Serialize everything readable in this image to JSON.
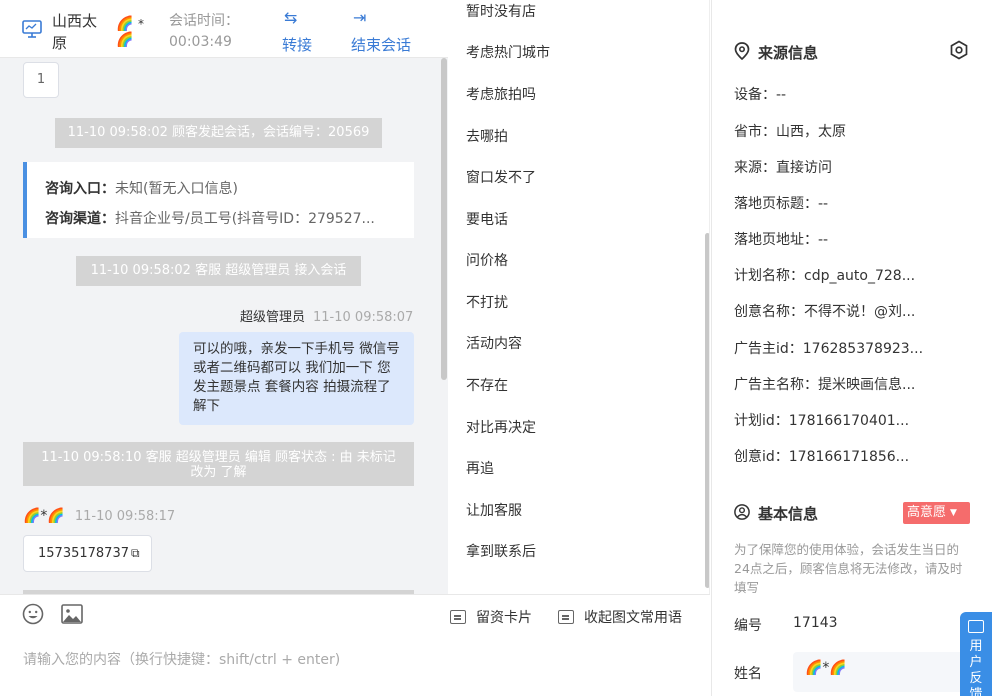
{
  "header": {
    "customer_name": "山西太原",
    "avatar": "🌈",
    "avatar_suffix": "*",
    "session_time_label": "会话时间：",
    "session_time": "00:03:49",
    "transfer_label": "转接",
    "end_label": "结束会话"
  },
  "chat": {
    "page_number": "1",
    "messages": {
      "sys_start": "11-10 09:58:02 顾客发起会话，会话编号：20569",
      "consult_entry_label": "咨询入口：",
      "consult_entry_value": "未知(暂无入口信息)",
      "consult_channel_label": "咨询渠道：",
      "consult_channel_value": "抖音企业号/员工号(抖音号ID：279527...",
      "sys_accept": "11-10 09:58:02 客服 超级管理员 接入会话",
      "agent_name": "超级管理员",
      "agent_time": "11-10 09:58:07",
      "agent_text": "可以的哦，亲发一下手机号 微信号或者二维码都可以 我们加一下 您发主题景点 套餐内容 拍摄流程了解下",
      "sys_edit": "11-10 09:58:10 客服 超级管理员 编辑 顾客状态 : 由 未标记 改为 了解",
      "guest_name": "🌈*🌈",
      "guest_time": "11-10 09:58:17",
      "guest_phone": "15735178737"
    }
  },
  "input": {
    "placeholder": "请输入您的内容（换行快捷键：shift/ctrl + enter)",
    "card_label": "留资卡片",
    "collapse_label": "收起图文常用语"
  },
  "phrases": [
    "暂时没有店",
    "考虑热门城市",
    "考虑旅拍吗",
    "去哪拍",
    "窗口发不了",
    "要电话",
    "问价格",
    "不打扰",
    "活动内容",
    "不存在",
    "对比再决定",
    "再追",
    "让加客服",
    "拿到联系后"
  ],
  "source_info": {
    "title": "来源信息",
    "rows": [
      "设备：--",
      "省市：山西，太原",
      "来源：直接访问",
      "落地页标题：--",
      "落地页地址：--",
      "计划名称：cdp_auto_728...",
      "创意名称：不得不说！@刘...",
      "广告主id：176285378923...",
      "广告主名称：提米映画信息...",
      "计划id：178166170401...",
      "创意id：178166171856..."
    ]
  },
  "basic_info": {
    "title": "基本信息",
    "intent_badge": "高意愿",
    "note": "为了保障您的使用体验，会话发生当日的24点之后，顾客信息将无法修改，请及时填写",
    "id_label": "编号",
    "id_value": "17143",
    "name_label": "姓名",
    "name_value": "🌈*🌈"
  },
  "feedback_tab": "用户反馈",
  "colors": {
    "accent": "#3a7bd5",
    "badge_red": "#f56c6c",
    "bubble": "#dce8fc",
    "system_msg": "#d4d4d4"
  }
}
